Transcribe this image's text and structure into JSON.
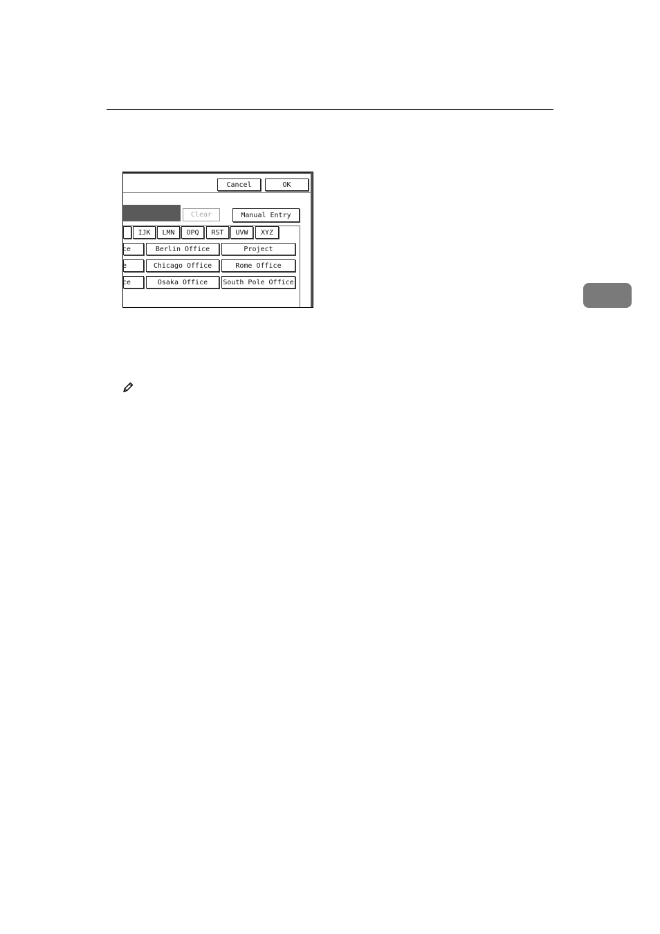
{
  "screen": {
    "cancel_label": "Cancel",
    "ok_label": "OK",
    "clear_label": "Clear",
    "manual_entry_label": "Manual Entry",
    "index_tabs": [
      "",
      "IJK",
      "LMN",
      "OPQ",
      "RST",
      "UVW",
      "XYZ"
    ],
    "destinations": [
      [
        "ce",
        "Berlin Office",
        "Project"
      ],
      [
        "e",
        "Chicago Office",
        "Rome Office"
      ],
      [
        "ce",
        "Osaka Office",
        "South Pole Office"
      ]
    ]
  },
  "icons": {
    "note": "pencil-icon",
    "section_tab": "chapter-tab-icon"
  }
}
